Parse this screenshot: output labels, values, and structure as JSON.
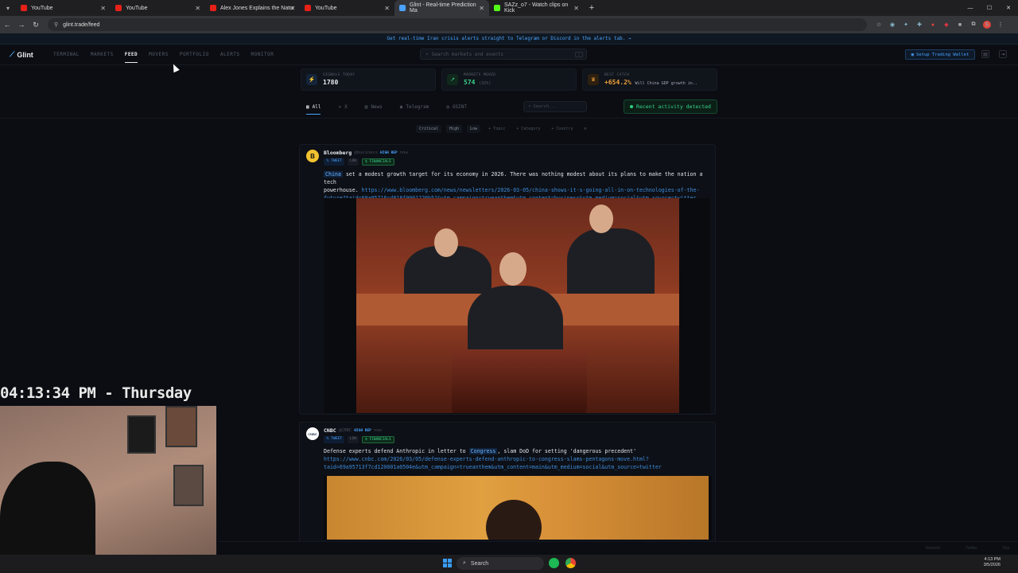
{
  "browser": {
    "tabs": [
      {
        "label": "YouTube",
        "color": "#e62117"
      },
      {
        "label": "YouTube",
        "color": "#e62117"
      },
      {
        "label": "Alex Jones Explains the Natur",
        "color": "#e62117"
      },
      {
        "label": "YouTube",
        "color": "#e62117"
      },
      {
        "label": "Glint - Real-time Prediction Ma",
        "color": "#4aa3ff"
      },
      {
        "label": "SAZz_o7 - Watch clips on Kick",
        "color": "#53fc18"
      }
    ],
    "url": "glint.trade/feed",
    "profile_initial": "S"
  },
  "announce": "Get real-time Iran crisis alerts straight to Telegram or Discord in the alerts tab. →",
  "app": {
    "logo": "Glint",
    "nav": [
      "TERMINAL",
      "MARKETS",
      "FEED",
      "MOVERS",
      "PORTFOLIO",
      "ALERTS",
      "MONITOR"
    ],
    "search_placeholder": "Search markets and events",
    "wallet_label": "Setup Trading Wallet"
  },
  "stats": [
    {
      "label": "SIGNALS TODAY",
      "value": "1780",
      "sub": ""
    },
    {
      "label": "MARKETS MOVED",
      "value": "574",
      "sub": "(32%)"
    },
    {
      "label": "BEST CATCH",
      "value": "+654.2%",
      "sub": "Will China GDP growth in.."
    }
  ],
  "filters": {
    "tabs": [
      "All",
      "X",
      "News",
      "Telegram",
      "OSINT"
    ],
    "search_placeholder": "Search...",
    "activity": "Recent activity detected",
    "chips": [
      "Critical",
      "High",
      "Low",
      "+ Topic",
      "+ Category",
      "+ Country"
    ]
  },
  "posts": [
    {
      "avatar": "B",
      "author": "Bloomberg",
      "handle": "@business",
      "rep": "HIGH REP",
      "age": "now",
      "tags": [
        "TWEET",
        "LOW",
        "FINANCIALS"
      ],
      "highlight": "China",
      "text": " set a modest growth target for its economy in 2026. There was nothing modest about its plans to make the nation a tech",
      "text2": "powerhouse.",
      "link": "https://www.bloomberg.com/news/newsletters/2026-03-05/china-shows-it-s-going-all-in-on-technologies-of-the-",
      "link2": "future?taid=69a95716cd818f0001220b51&utm_campaign=trueanthem&utm_content=business&utm_medium=social&utm_source=twitter"
    },
    {
      "avatar": "CNBC",
      "author": "CNBC",
      "handle": "@CNBC",
      "rep": "HIGH REP",
      "age": "now",
      "tags": [
        "TWEET",
        "LOW",
        "FINANCIALS"
      ],
      "text_a": "Defense experts defend Anthropic in letter to ",
      "highlight": "Congress",
      "text_b": ", slam DoD for setting 'dangerous precedent'",
      "link": "https://www.cnbc.com/2026/03/05/defense-experts-defend-anthropic-to-congress-slams-pentagons-move.html?",
      "link2": "taid=69a95713f7cd120001a0504e&utm_campaign=trueanthem&utm_content=main&utm_medium=social&utm_source=twitter"
    }
  ],
  "overlay": {
    "clock": "04:13:34 PM - Thursday"
  },
  "taskbar": {
    "search": "Search",
    "time": "4:13 PM",
    "date": "3/5/2026"
  },
  "footer": [
    "Network",
    "Twitter",
    "Tool"
  ]
}
